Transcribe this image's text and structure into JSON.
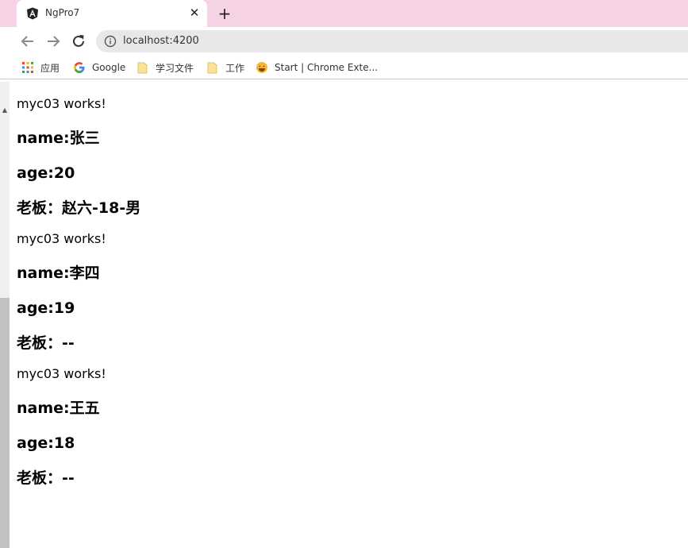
{
  "browser": {
    "tab": {
      "title": "NgPro7",
      "close": "✕"
    },
    "new_tab": "+",
    "url": "localhost:4200",
    "bookmarks": [
      {
        "label": "应用"
      },
      {
        "label": "Google"
      },
      {
        "label": "学习文件"
      },
      {
        "label": "工作"
      },
      {
        "label": "Start | Chrome Exte..."
      }
    ]
  },
  "page": {
    "items": [
      {
        "works": "myc03 works!",
        "name": "name:张三",
        "age": "age:20",
        "boss": "老板：赵六-18-男"
      },
      {
        "works": "myc03 works!",
        "name": "name:李四",
        "age": "age:19",
        "boss": "老板：--"
      },
      {
        "works": "myc03 works!",
        "name": "name:王五",
        "age": "age:18",
        "boss": "老板：--"
      }
    ]
  },
  "colors": {
    "tabstrip": "#f5d3e5",
    "omnibox": "#e8e8e8"
  }
}
